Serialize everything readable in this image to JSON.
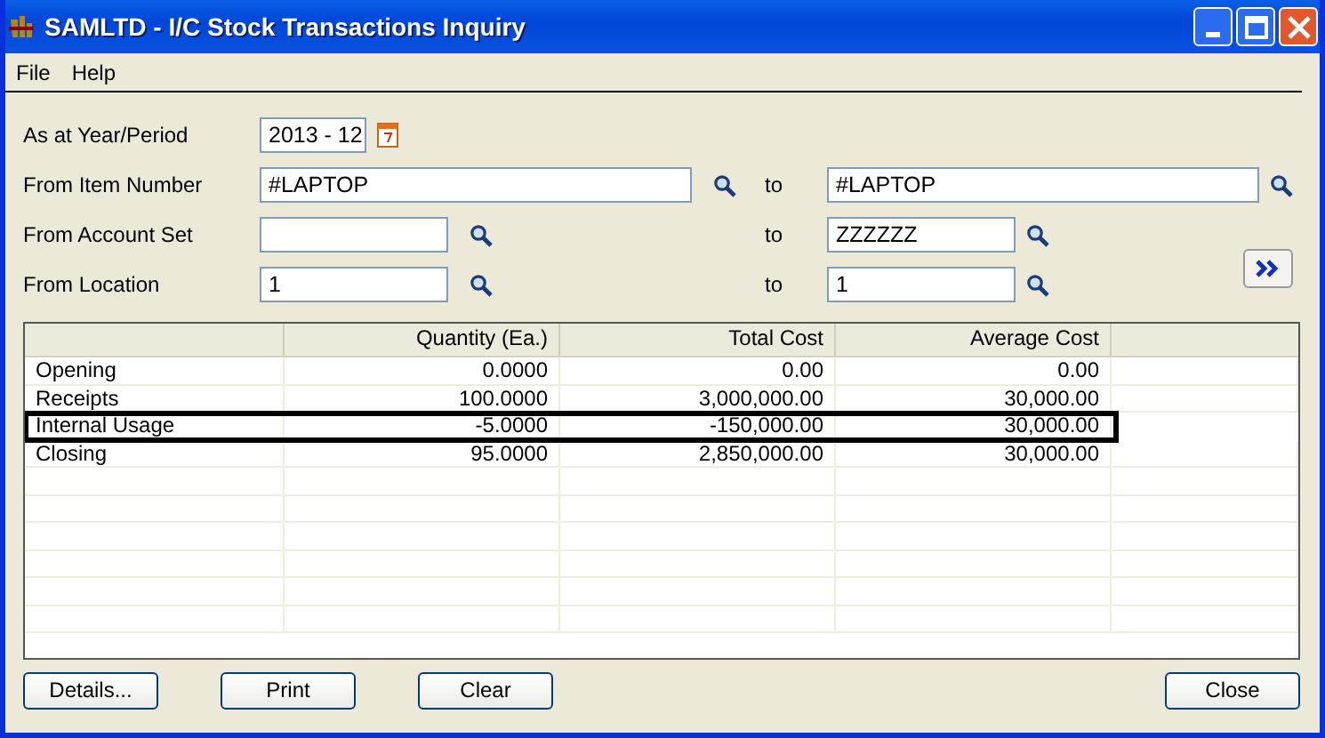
{
  "window": {
    "title": "SAMLTD - I/C Stock Transactions Inquiry"
  },
  "menu": [
    "File",
    "Help"
  ],
  "filters": [
    {
      "label": "As at Year/Period",
      "kind": "period",
      "from": "2013 - 12"
    },
    {
      "label": "From Item Number",
      "kind": "wide",
      "from": "#LAPTOP",
      "to_label": "to",
      "to": "#LAPTOP"
    },
    {
      "label": "From Account Set",
      "kind": "narrow",
      "to_label": "to",
      "to": "ZZZZZZ"
    },
    {
      "label": "From Location",
      "kind": "narrow",
      "from": "1",
      "to_label": "to",
      "to": "1"
    }
  ],
  "table": {
    "columns": [
      "",
      "Quantity (Ea.)",
      "Total Cost",
      "Average Cost"
    ],
    "rows": [
      {
        "cells": [
          "Opening",
          "0.0000",
          "0.00",
          "0.00"
        ],
        "highlighted": false
      },
      {
        "cells": [
          "Receipts",
          "100.0000",
          "3,000,000.00",
          "30,000.00"
        ],
        "highlighted": false
      },
      {
        "cells": [
          "Internal Usage",
          "-5.0000",
          "-150,000.00",
          "30,000.00"
        ],
        "highlighted": true
      },
      {
        "cells": [
          "Closing",
          "95.0000",
          "2,850,000.00",
          "30,000.00"
        ],
        "highlighted": false
      }
    ]
  },
  "buttons_left": [
    "Details...",
    "Print",
    "Clear"
  ],
  "buttons_right": [
    "Close"
  ]
}
